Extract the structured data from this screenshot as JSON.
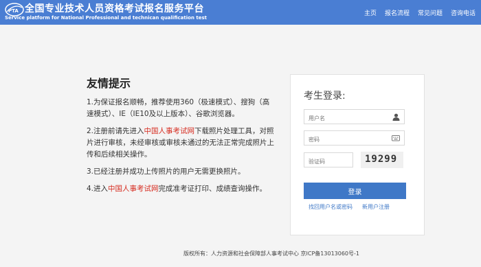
{
  "header": {
    "title": "全国专业技术人员资格考试报名服务平台",
    "subtitle": "Service platform for National Professional and technican qualification test",
    "nav": [
      "主页",
      "报名流程",
      "常见问题",
      "咨询电话"
    ]
  },
  "tips": {
    "title": "友情提示",
    "items": [
      {
        "a": "1.为保证报名顺畅，推荐使用360（极速模式）、搜狗（高速模式）、IE（IE10及以上版本）、谷歌浏览器。",
        "link": "",
        "b": ""
      },
      {
        "a": "2.注册前请先进入",
        "link": "中国人事考试网",
        "b": "下载照片处理工具，对照片进行审核，未经审核或审核未通过的无法正常完成照片上传和后续相关操作。"
      },
      {
        "a": "3.已经注册并成功上传照片的用户无需更换照片。",
        "link": "",
        "b": ""
      },
      {
        "a": "4.进入",
        "link": "中国人事考试网",
        "b": "完成准考证打印、成绩查询操作。"
      }
    ]
  },
  "login": {
    "title": "考生登录:",
    "username_placeholder": "用户名",
    "password_placeholder": "密码",
    "captcha_placeholder": "验证码",
    "captcha_text": "19299",
    "submit_label": "登录",
    "forgot_label": "找回用户名或密码",
    "register_label": "新用户注册"
  },
  "footer": {
    "text": "版权所有：人力资源和社会保障部人事考试中心 京ICP备13013060号-1"
  },
  "colors": {
    "header": "#4a7ed3",
    "accent": "#3f78c7",
    "link_red": "#d62b1f"
  }
}
